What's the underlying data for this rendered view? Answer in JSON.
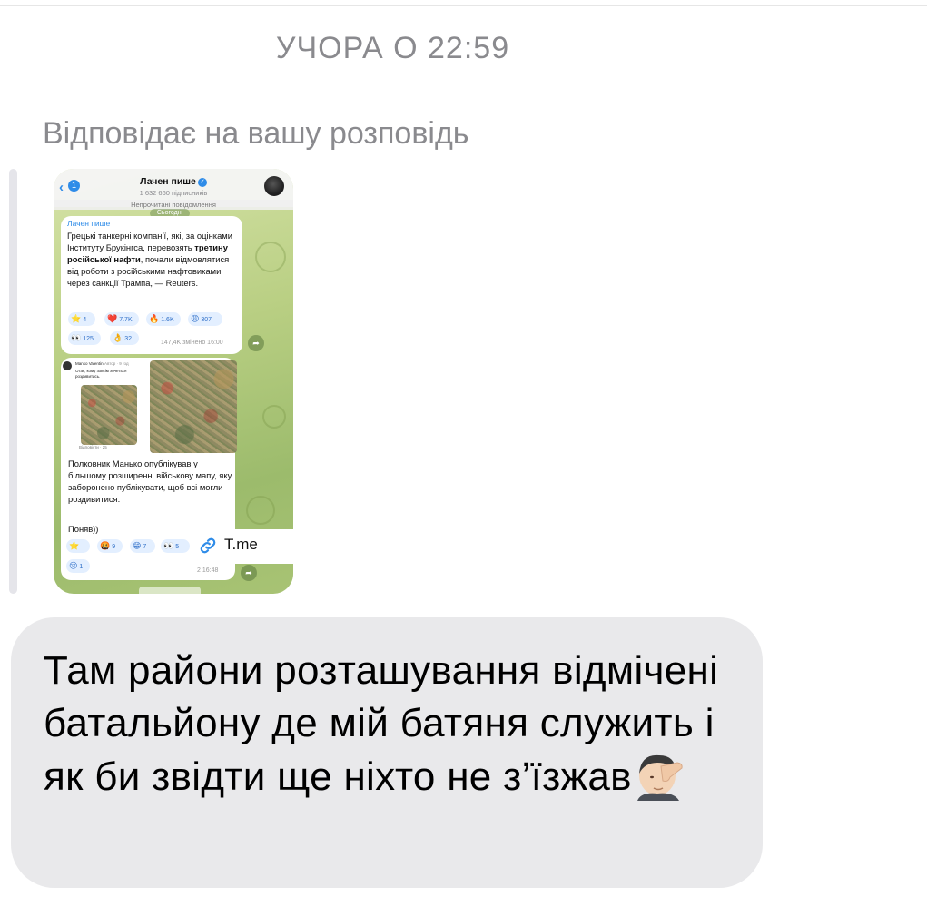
{
  "conversation": {
    "timestamp": "УЧОРА О 22:59",
    "reply_note": "Відповідає на вашу розповідь"
  },
  "story": {
    "channel": {
      "back_count": "1",
      "title": "Лачен пише",
      "subscribers": "1 632 660 підписників",
      "unread_banner": "Непрочитані повідомлення",
      "date_pill": "Сьогодні"
    },
    "post1": {
      "author": "Лачен пише",
      "text_a": "Грецькі танкерні компанії, які, за оцінками Інституту Брукінгса, перевозять ",
      "text_bold": "третину російської нафти",
      "text_b": ", почали відмовлятися від роботи з російськими нафтовиками через санкції Трампа, — Reuters.",
      "reactions": [
        {
          "emoji": "⭐",
          "count": "4"
        },
        {
          "emoji": "❤️",
          "count": "7.7K"
        },
        {
          "emoji": "🔥",
          "count": "1.6K"
        },
        {
          "emoji": "😩",
          "count": "307"
        },
        {
          "emoji": "👀",
          "count": "125"
        },
        {
          "emoji": "👌",
          "count": "32"
        }
      ],
      "meta": "147,4K змінено 16:00"
    },
    "post2": {
      "embedded": {
        "name": "Manko Valentin",
        "badge": "Автор · 9 год",
        "text": "Отак, кому зовсім хочеться роздивитись.",
        "footer": "Відповісти · 25"
      },
      "text": "Полковник Манько опублікував у більшому розширенні військову мапу, яку заборонено публікувати, щоб всі могли роздивитися.",
      "text2": "Поняв))",
      "reactions": [
        {
          "emoji": "⭐",
          "count": ""
        },
        {
          "emoji": "🤬",
          "count": "9"
        },
        {
          "emoji": "😁",
          "count": "7"
        },
        {
          "emoji": "👀",
          "count": "5"
        },
        {
          "emoji": "😢",
          "count": "1"
        }
      ],
      "meta": "2 16:48"
    },
    "link_sticker": {
      "label": "T.me",
      "icon": "link-icon"
    }
  },
  "message": {
    "text": "Там райони розташування відмічені батальйону де мій батяня служить і як би звідти ще ніхто не з’їзжав",
    "emoji": "🤦🏻‍♂️"
  },
  "colors": {
    "bubble_bg": "#e9e9eb",
    "meta_gray": "#8a8a8e",
    "telegram_blue": "#2f8ce8"
  }
}
